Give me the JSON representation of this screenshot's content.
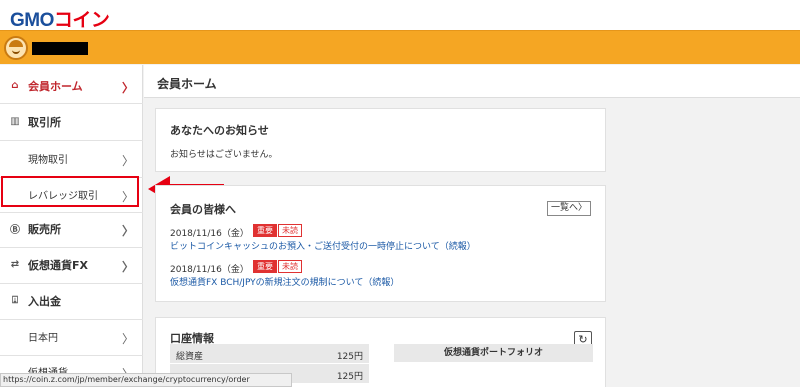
{
  "brand": {
    "logo_text": "GMO",
    "logo_accent": "コイン"
  },
  "sidebar": {
    "items": [
      {
        "label": "会員ホーム"
      },
      {
        "label": "取引所"
      },
      {
        "label": "現物取引"
      },
      {
        "label": "レバレッジ取引"
      },
      {
        "label": "販売所"
      },
      {
        "label": "仮想通貨FX"
      },
      {
        "label": "入出金"
      },
      {
        "label": "日本円"
      },
      {
        "label": "仮想通貨"
      }
    ]
  },
  "main": {
    "title": "会員ホーム"
  },
  "notices": {
    "title": "あなたへのお知らせ",
    "empty_text": "お知らせはございません。"
  },
  "announcements": {
    "title": "会員の皆様へ",
    "more_label": "一覧へ〉",
    "items": [
      {
        "date": "2018/11/16（金）",
        "tag_important": "重要",
        "tag_unread": "未読",
        "title": "ビットコインキャッシュのお預入・ご送付受付の一時停止について（続報）"
      },
      {
        "date": "2018/11/16（金）",
        "tag_important": "重要",
        "tag_unread": "未読",
        "title": "仮想通貨FX BCH/JPYの新規注文の規制について（続報）"
      }
    ]
  },
  "account": {
    "title": "口座情報",
    "rows": [
      {
        "label": "総資産",
        "value": "125円"
      },
      {
        "label": "",
        "value": "125円"
      }
    ],
    "portfolio_label": "仮想通貨ポートフォリオ"
  },
  "statusbar": {
    "url": "https://coin.z.com/jp/member/exchange/cryptocurrency/order"
  },
  "colors": {
    "accent_orange": "#f5a623",
    "accent_red": "#e60012",
    "link_blue": "#1c5aa6"
  }
}
